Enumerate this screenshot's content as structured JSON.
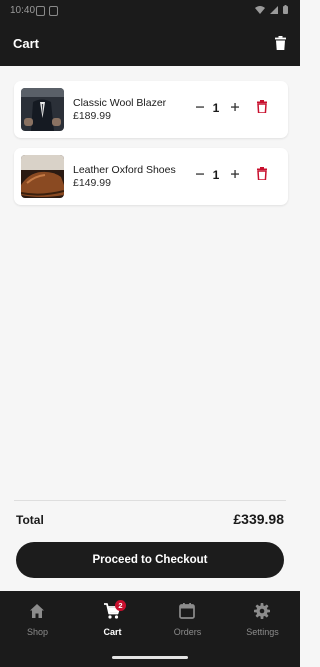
{
  "app_bar": {
    "title": "Cart"
  },
  "cart": {
    "items": [
      {
        "name": "Classic Wool Blazer",
        "price": "£189.99",
        "quantity": "1"
      },
      {
        "name": "Leather Oxford Shoes",
        "price": "£149.99",
        "quantity": "1"
      }
    ]
  },
  "summary": {
    "total_label": "Total",
    "total_value": "£339.98"
  },
  "checkout": {
    "label": "Proceed to Checkout"
  },
  "nav": {
    "items": [
      {
        "label": "Shop",
        "icon": "home-icon"
      },
      {
        "label": "Cart",
        "icon": "cart-icon",
        "badge": "2",
        "active": true
      },
      {
        "label": "Orders",
        "icon": "calendar-icon"
      },
      {
        "label": "Settings",
        "icon": "gear-icon"
      }
    ]
  },
  "colors": {
    "accent": "#c8102e",
    "bar_background": "#1b1b1b",
    "page_background": "#f6f6f6"
  }
}
